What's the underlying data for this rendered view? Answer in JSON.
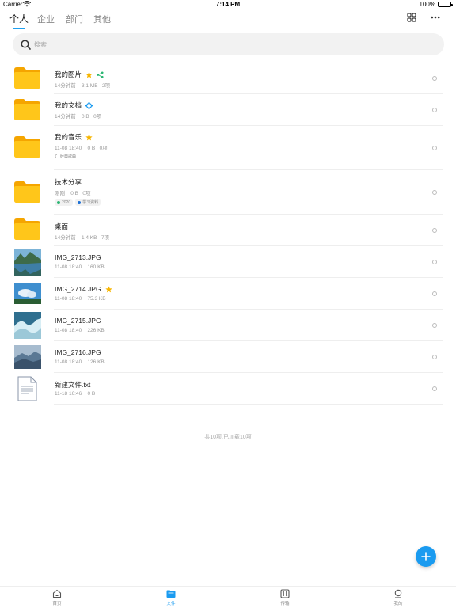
{
  "status_bar": {
    "carrier": "Carrier",
    "time": "7:14 PM",
    "battery": "100%"
  },
  "top_tabs": [
    {
      "label": "个人",
      "active": true
    },
    {
      "label": "企业",
      "active": false
    },
    {
      "label": "部门",
      "active": false
    },
    {
      "label": "其他",
      "active": false
    }
  ],
  "header": {
    "grid_icon": "grid-view-icon",
    "more_icon": "more-icon"
  },
  "search": {
    "placeholder": "搜索"
  },
  "files": [
    {
      "name": "我的图片",
      "meta": "14分钟前    3.1 MB   2项",
      "kind": "folder",
      "starred": true,
      "extra_icon": "share-icon",
      "tags": []
    },
    {
      "name": "我的文档",
      "meta": "14分钟前    0 B   0项",
      "kind": "folder",
      "starred": false,
      "extra_icon": "sync-icon",
      "tags": []
    },
    {
      "name": "我的音乐",
      "meta": "11-08 18:40    0 B   0项",
      "kind": "folder",
      "starred": true,
      "extra_icon": "",
      "tags": [
        {
          "label": "经典歌曲",
          "color": ""
        }
      ]
    },
    {
      "name": "技术分享",
      "meta": "刚刚    0 B   0项",
      "kind": "folder",
      "starred": false,
      "extra_icon": "",
      "tags": [
        {
          "label": "2020",
          "color": "#2bb673"
        },
        {
          "label": "学习资料",
          "color": "#1a6fd6"
        }
      ]
    },
    {
      "name": "桌面",
      "meta": "14分钟前    1.4 KB   7项",
      "kind": "folder",
      "starred": false,
      "extra_icon": "",
      "tags": []
    },
    {
      "name": "IMG_2713.JPG",
      "meta": "11-08 18:40    160 KB",
      "kind": "photo",
      "starred": false,
      "extra_icon": "",
      "tags": []
    },
    {
      "name": "IMG_2714.JPG",
      "meta": "11-08 18:40    75.3 KB",
      "kind": "photo",
      "starred": true,
      "extra_icon": "",
      "tags": []
    },
    {
      "name": "IMG_2715.JPG",
      "meta": "11-08 18:40    226 KB",
      "kind": "photo",
      "starred": false,
      "extra_icon": "",
      "tags": []
    },
    {
      "name": "IMG_2716.JPG",
      "meta": "11-08 18:40    126 KB",
      "kind": "photo",
      "starred": false,
      "extra_icon": "",
      "tags": []
    },
    {
      "name": "新建文件.txt",
      "meta": "11-18 16:46    0 B",
      "kind": "text",
      "starred": false,
      "extra_icon": "",
      "tags": []
    }
  ],
  "summary": "共10项,已加载10项",
  "bottom_nav": [
    {
      "label": "首页",
      "icon": "home-icon",
      "active": false
    },
    {
      "label": "文件",
      "icon": "folder-icon",
      "active": true
    },
    {
      "label": "传输",
      "icon": "transfer-icon",
      "active": false
    },
    {
      "label": "我的",
      "icon": "profile-icon",
      "active": false
    }
  ],
  "colors": {
    "accent": "#1a9bf0",
    "folder": "#ffc61a",
    "star": "#f7b500",
    "share": "#2bb673"
  }
}
